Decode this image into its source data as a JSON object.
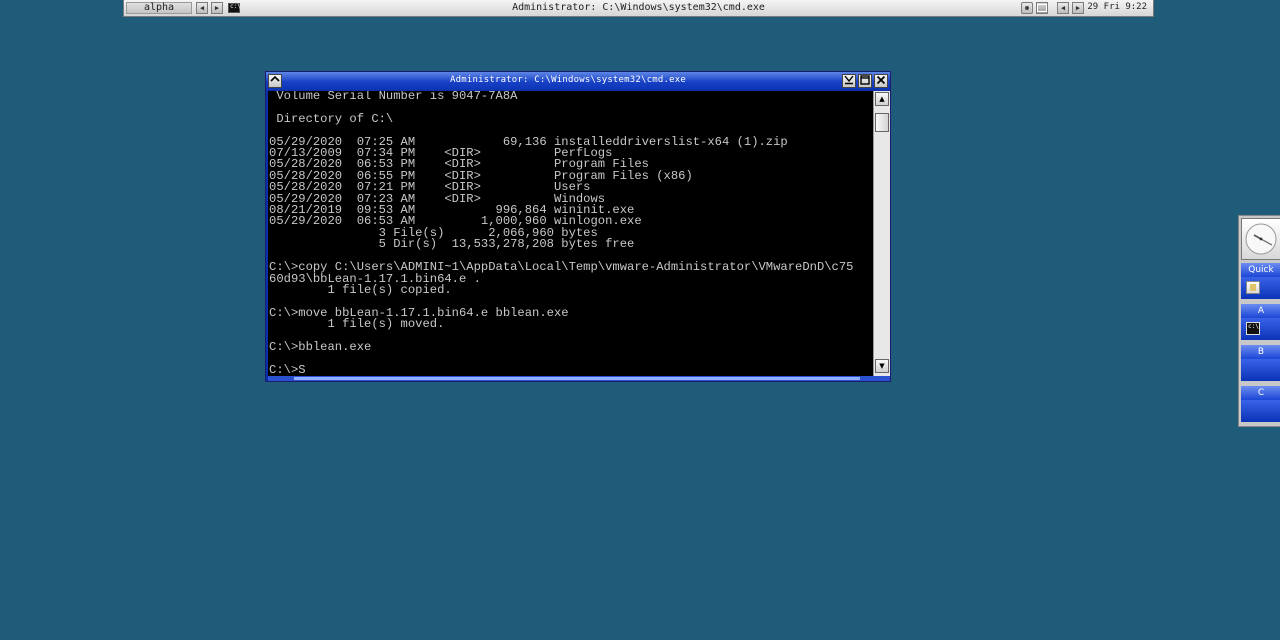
{
  "toolbar": {
    "workspace_label": "alpha",
    "prev_workspace_glyph": "◀",
    "next_workspace_glyph": "▶",
    "window_title": "Administrator: C:\\Windows\\system32\\cmd.exe",
    "prev_window_glyph": "◀",
    "next_window_glyph": "▶",
    "clock": "29 Fri 9:22"
  },
  "cmd_window": {
    "title": "Administrator: C:\\Windows\\system32\\cmd.exe",
    "console_lines": [
      " Volume Serial Number is 9047-7A8A",
      "",
      " Directory of C:\\",
      "",
      "05/29/2020  07:25 AM            69,136 installeddriverslist-x64 (1).zip",
      "07/13/2009  07:34 PM    <DIR>          PerfLogs",
      "05/28/2020  06:53 PM    <DIR>          Program Files",
      "05/28/2020  06:55 PM    <DIR>          Program Files (x86)",
      "05/28/2020  07:21 PM    <DIR>          Users",
      "05/29/2020  07:23 AM    <DIR>          Windows",
      "08/21/2019  09:53 AM           996,864 wininit.exe",
      "05/29/2020  06:53 AM         1,000,960 winlogon.exe",
      "               3 File(s)      2,066,960 bytes",
      "               5 Dir(s)  13,533,278,208 bytes free",
      "",
      "C:\\>copy C:\\Users\\ADMINI~1\\AppData\\Local\\Temp\\vmware-Administrator\\VMwareDnD\\c75",
      "60d93\\bbLean-1.17.1.bin64.e .",
      "        1 file(s) copied.",
      "",
      "C:\\>move bbLean-1.17.1.bin64.e bblean.exe",
      "        1 file(s) moved.",
      "",
      "C:\\>bblean.exe",
      "",
      "C:\\>S"
    ]
  },
  "slit": {
    "toolbar_header": "Quick",
    "workspace_a": "A",
    "workspace_b": "B",
    "workspace_c": "C"
  }
}
